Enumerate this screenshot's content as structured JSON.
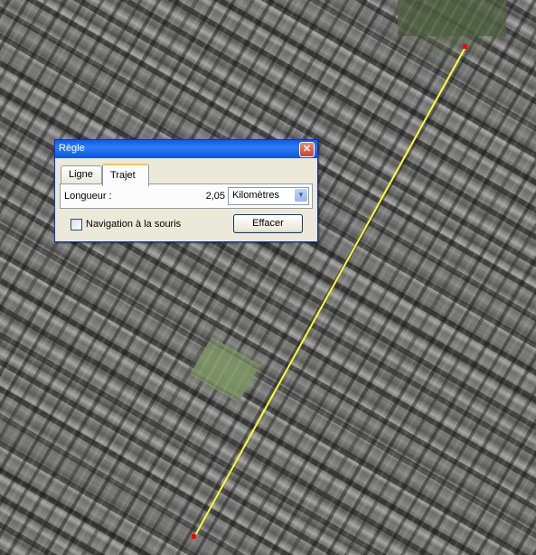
{
  "dialog": {
    "title": "Règle",
    "close_glyph": "✕",
    "tabs": [
      {
        "label": "Ligne",
        "active": false
      },
      {
        "label": "Trajet",
        "active": true
      }
    ],
    "length_label": "Longueur :",
    "length_value": "2,05",
    "unit_selected": "Kilomètres",
    "mouse_nav_label": "Navigation à la souris",
    "mouse_nav_checked": false,
    "clear_label": "Effacer"
  },
  "measure_line": {
    "color": "#ffff33",
    "endpoint_color": "#ff0000"
  },
  "map": {
    "type": "satellite-imagery"
  }
}
